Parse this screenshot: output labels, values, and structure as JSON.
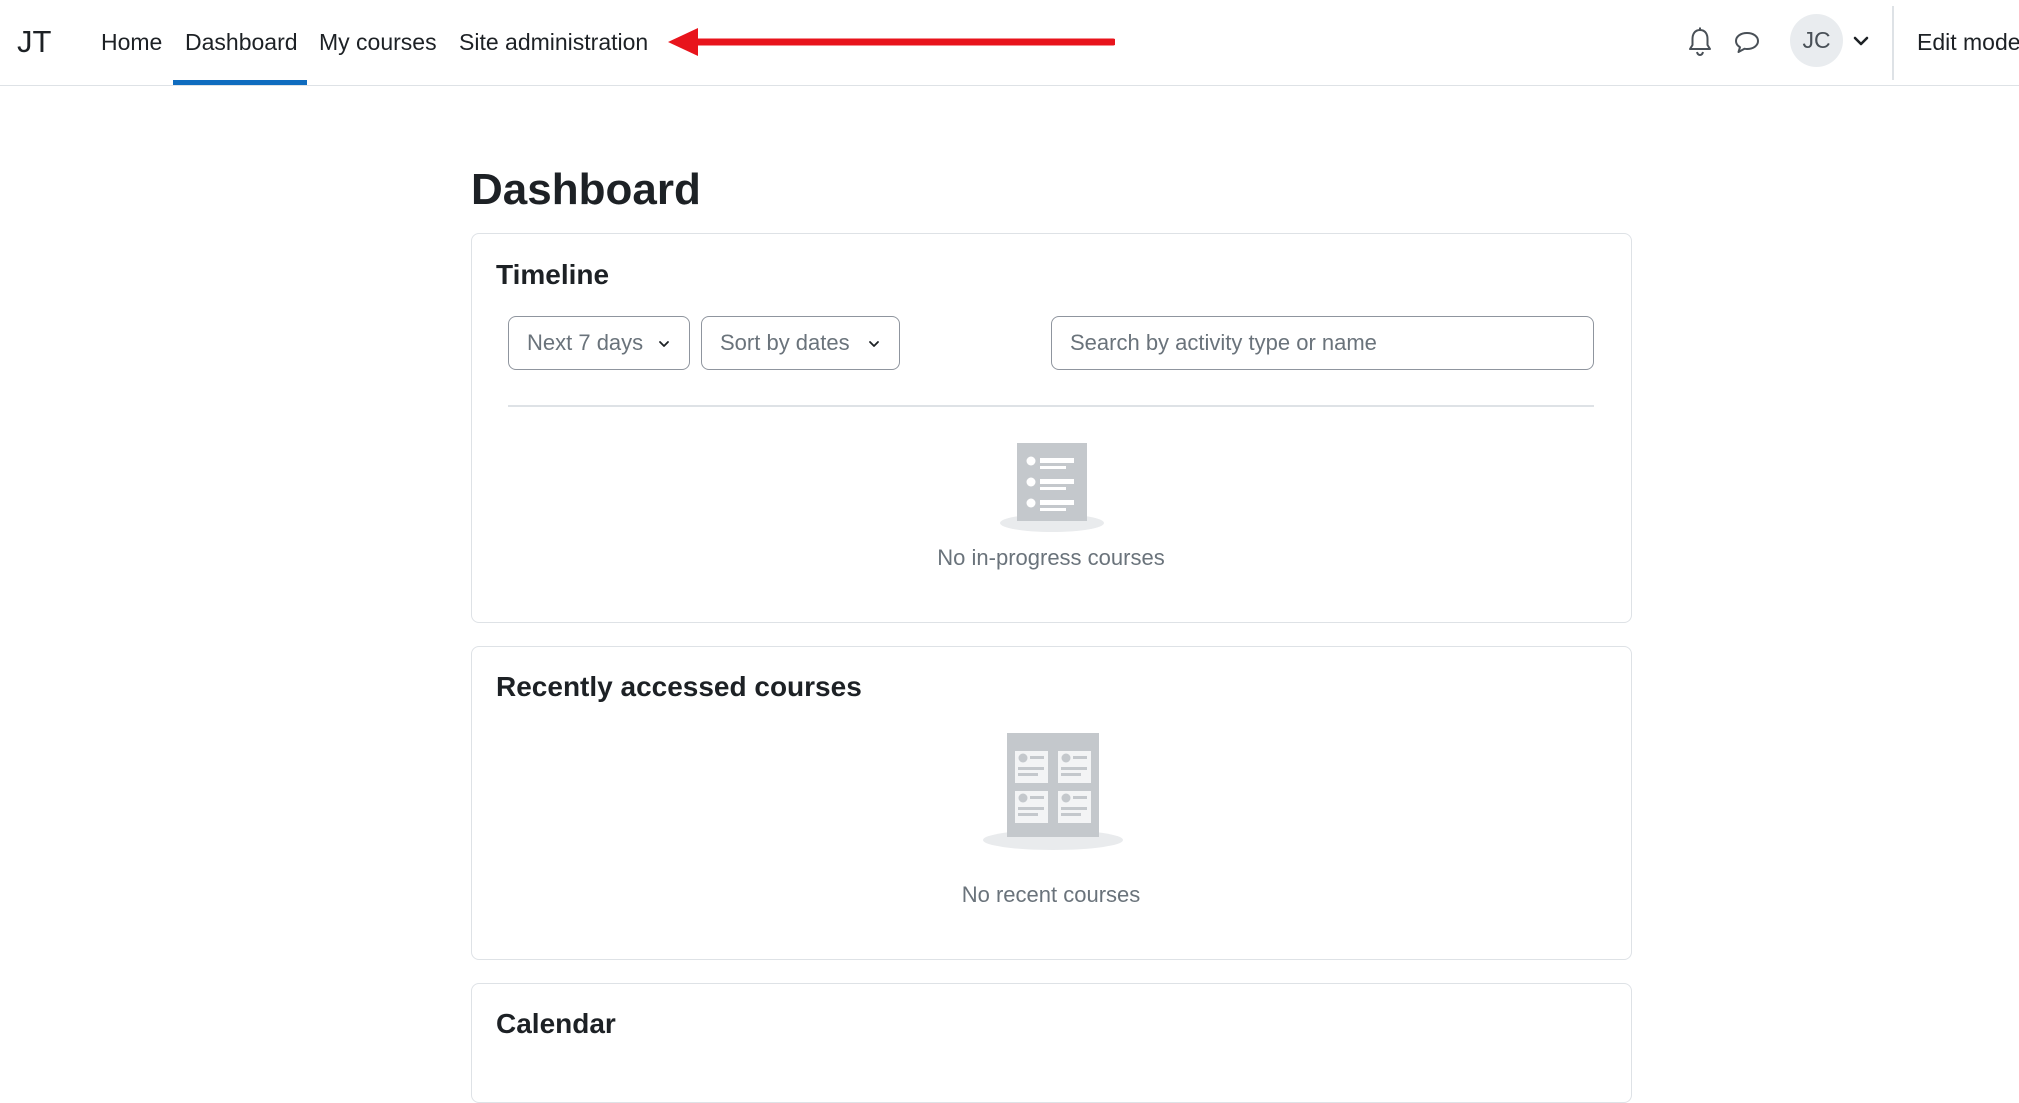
{
  "navbar": {
    "brand": "JT",
    "links": {
      "home": "Home",
      "dashboard": "Dashboard",
      "my_courses": "My courses",
      "site_administration": "Site administration"
    },
    "active_link": "Dashboard",
    "icons": {
      "notifications": "bell-icon",
      "messages": "chat-bubble-icon",
      "user_menu_caret": "chevron-down-icon"
    },
    "user_initials": "JC",
    "edit_mode_label": "Edit mode"
  },
  "annotation": {
    "arrow_color": "#e8141c",
    "points_to": "Site administration"
  },
  "page": {
    "title": "Dashboard"
  },
  "timeline": {
    "title": "Timeline",
    "filter_selected": "Next 7 days",
    "sort_selected": "Sort by dates",
    "search_placeholder": "Search by activity type or name",
    "search_value": "",
    "empty_message": "No in-progress courses",
    "empty_icon": "checklist-illustration"
  },
  "recent_courses": {
    "title": "Recently accessed courses",
    "empty_message": "No recent courses",
    "empty_icon": "course-grid-illustration"
  },
  "calendar": {
    "title": "Calendar"
  },
  "colors": {
    "accent": "#0f6cbf",
    "text": "#1d2125",
    "muted_text": "#6a737b",
    "border": "#dee2e6",
    "illustration_gray": "#c4c8cc"
  }
}
